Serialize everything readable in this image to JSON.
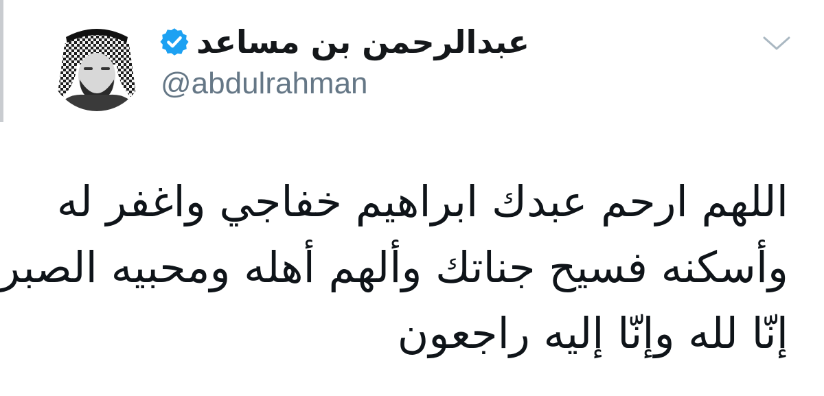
{
  "tweet": {
    "author": {
      "display_name": "عبدالرحمن بن مساعد",
      "handle": "@abdulrahman",
      "verified": true,
      "verified_icon": "verified-badge-icon",
      "verified_color": "#1da1f2"
    },
    "menu_icon": "chevron-down-icon",
    "text_lines": [
      "اللهم ارحم عبدك ابراهيم خفاجي واغفر له",
      "وأسكنه فسيح جناتك وألهم أهله ومحبيه الصبر",
      "إنّا لله وإنّا إليه راجعون"
    ]
  },
  "colors": {
    "name": "#14171a",
    "handle": "#657786",
    "text": "#0f1419",
    "chevron": "#aab8c2"
  }
}
